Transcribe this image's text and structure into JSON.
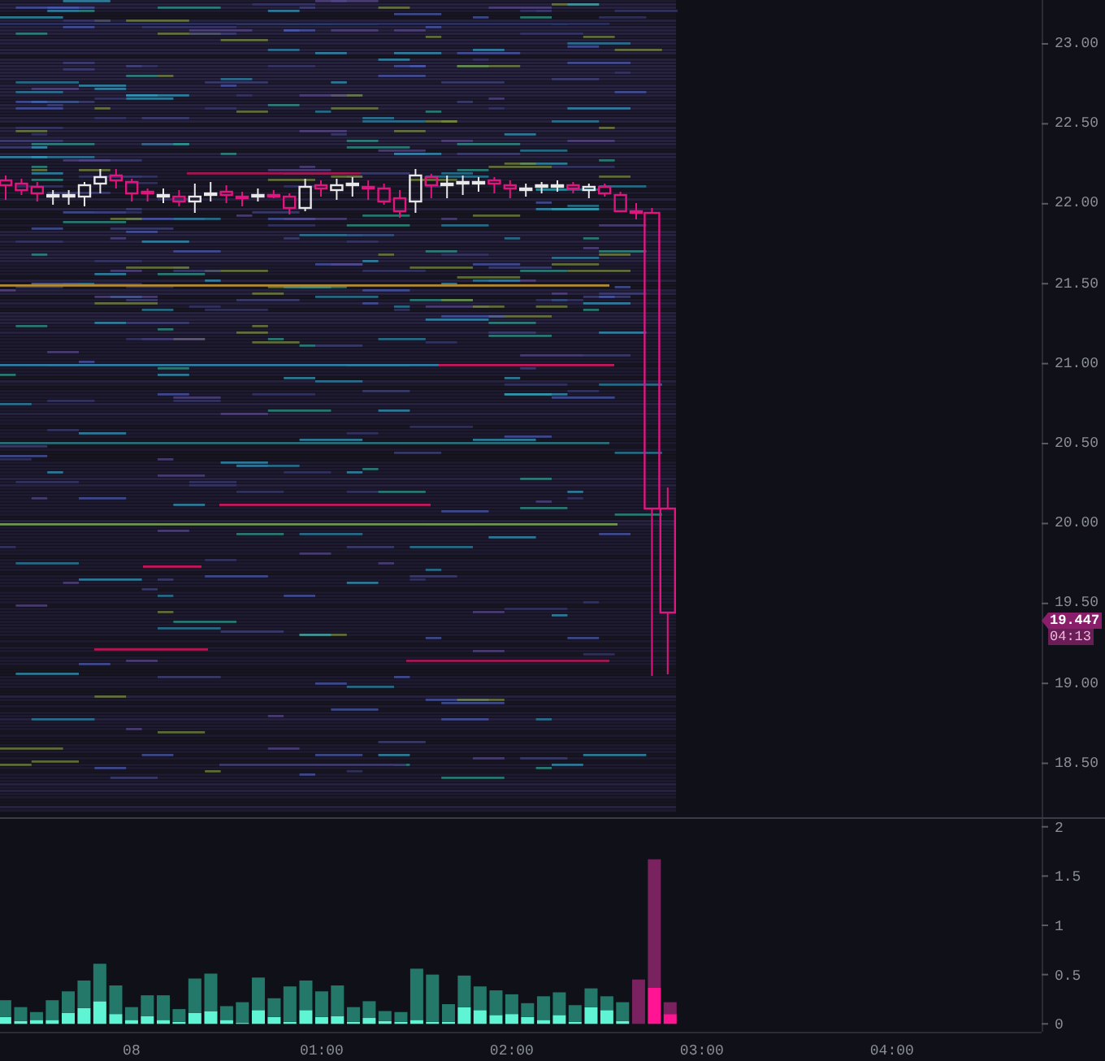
{
  "price_axis": {
    "ticks": [
      "23.00",
      "22.50",
      "22.00",
      "21.50",
      "21.00",
      "20.50",
      "20.00",
      "19.50",
      "19.00",
      "18.50"
    ]
  },
  "last_price": {
    "value": "19.447",
    "countdown": "04:13"
  },
  "volume": {
    "day_label": "08",
    "chart_data": {
      "type": "bar",
      "stacked": true,
      "ylim": [
        -0.08,
        2.08
      ],
      "yticks": [
        {
          "value": 0,
          "label": "0"
        },
        {
          "value": 0.5,
          "label": "0.5"
        },
        {
          "value": 1,
          "label": "1"
        },
        {
          "value": 1.5,
          "label": "1.5"
        },
        {
          "value": 2,
          "label": "2"
        }
      ],
      "x": [
        -0.667,
        -0.583,
        -0.5,
        -0.417,
        -0.333,
        -0.25,
        -0.167,
        -0.083,
        0,
        0.083,
        0.167,
        0.25,
        0.333,
        0.417,
        0.5,
        0.583,
        0.667,
        0.75,
        0.833,
        0.917,
        1,
        1.083,
        1.167,
        1.25,
        1.333,
        1.417,
        1.5,
        1.583,
        1.667,
        1.75,
        1.833,
        1.917,
        2,
        2.083,
        2.167,
        2.25,
        2.333,
        2.417,
        2.5,
        2.583,
        2.667,
        2.75,
        2.833
      ],
      "xlim": [
        -0.692,
        4.787
      ],
      "xticks": [
        {
          "value": 1,
          "label": "01:00"
        },
        {
          "value": 2,
          "label": "02:00"
        },
        {
          "value": 3,
          "label": "03:00"
        },
        {
          "value": 4,
          "label": "04:00"
        }
      ],
      "series": [
        {
          "color": "#5ff5d4",
          "values": [
            0.07,
            0.03,
            0.04,
            0.04,
            0.11,
            0.16,
            0.23,
            0.1,
            0.04,
            0.08,
            0.04,
            0.02,
            0.11,
            0.13,
            0.04,
            0.01,
            0.14,
            0.07,
            0.02,
            0.14,
            0.07,
            0.08,
            0.02,
            0.06,
            0.03,
            0.02,
            0.04,
            0.02,
            0.02,
            0.17,
            0.14,
            0.09,
            0.1,
            0.07,
            0.04,
            0.09,
            0.02,
            0.17,
            0.14,
            0.03,
            0,
            0,
            0
          ]
        },
        {
          "color": "#23786a",
          "values": [
            0.17,
            0.14,
            0.08,
            0.2,
            0.22,
            0.28,
            0.38,
            0.29,
            0.13,
            0.21,
            0.25,
            0.13,
            0.35,
            0.38,
            0.14,
            0.21,
            0.33,
            0.19,
            0.36,
            0.3,
            0.26,
            0.31,
            0.15,
            0.17,
            0.1,
            0.1,
            0.52,
            0.48,
            0.18,
            0.32,
            0.24,
            0.25,
            0.2,
            0.14,
            0.24,
            0.23,
            0.17,
            0.19,
            0.14,
            0.19,
            0,
            0,
            0
          ]
        },
        {
          "color": "#ff1493",
          "values": [
            0,
            0,
            0,
            0,
            0,
            0,
            0,
            0,
            0,
            0,
            0,
            0,
            0,
            0,
            0,
            0,
            0,
            0,
            0,
            0,
            0,
            0,
            0,
            0,
            0,
            0,
            0,
            0,
            0,
            0,
            0,
            0,
            0,
            0,
            0,
            0,
            0,
            0,
            0,
            0,
            0,
            0.37,
            0.1
          ]
        },
        {
          "color": "#7a2160",
          "values": [
            0,
            0,
            0,
            0,
            0,
            0,
            0,
            0,
            0,
            0,
            0,
            0,
            0,
            0,
            0,
            0,
            0,
            0,
            0,
            0,
            0,
            0,
            0,
            0,
            0,
            0,
            0,
            0,
            0,
            0,
            0,
            0,
            0,
            0,
            0,
            0,
            0,
            0,
            0,
            0,
            0.45,
            1.3,
            0.12
          ]
        }
      ]
    }
  }
}
